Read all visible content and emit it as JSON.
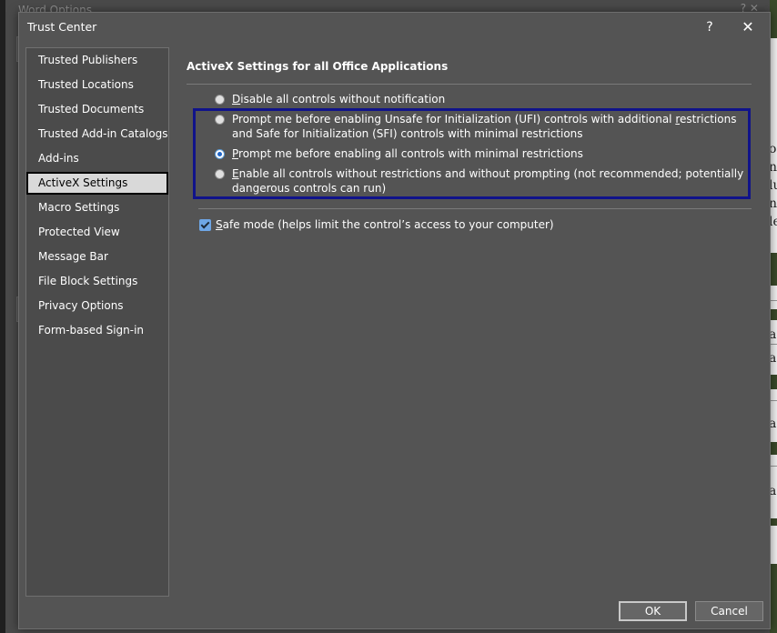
{
  "background_window": {
    "title": "Word Options",
    "controls": "?   ✕  ",
    "right_fragments": [
      "o",
      "n",
      "lu",
      "n",
      "le",
      "a",
      "a",
      "a",
      "a"
    ]
  },
  "dialog": {
    "title": "Trust Center",
    "help_label": "?",
    "close_label": "✕"
  },
  "sidebar": {
    "items": [
      {
        "label": "Trusted Publishers"
      },
      {
        "label": "Trusted Locations"
      },
      {
        "label": "Trusted Documents"
      },
      {
        "label": "Trusted Add-in Catalogs"
      },
      {
        "label": "Add-ins"
      },
      {
        "label": "ActiveX Settings",
        "selected": true
      },
      {
        "label": "Macro Settings"
      },
      {
        "label": "Protected View"
      },
      {
        "label": "Message Bar"
      },
      {
        "label": "File Block Settings"
      },
      {
        "label": "Privacy Options"
      },
      {
        "label": "Form-based Sign-in"
      }
    ]
  },
  "main": {
    "section_title": "ActiveX Settings for all Office Applications",
    "options": [
      {
        "accel": "D",
        "rest": "isable all controls without notification",
        "checked": false
      },
      {
        "pre": "Prompt me before enabling Unsafe for Initialization (UFI) controls with additional ",
        "accel": "r",
        "rest": "estrictions and Safe for Initialization (SFI) controls with minimal restrictions",
        "checked": false
      },
      {
        "accel": "P",
        "rest": "rompt me before enabling all controls with minimal restrictions",
        "checked": true
      },
      {
        "accel": "E",
        "rest": "nable all controls without restrictions and without prompting (not recommended; potentially dangerous controls can run)",
        "checked": false
      }
    ],
    "safe_mode": {
      "accel": "S",
      "rest": "afe mode (helps limit the control’s access to your computer)",
      "checked": true
    }
  },
  "footer": {
    "ok_label": "OK",
    "cancel_label": "Cancel"
  },
  "colors": {
    "dialog_bg": "#545454",
    "highlight_border": "#10138a",
    "radio_checked": "#1f66c9",
    "checkbox_fill": "#6ea6e6"
  }
}
